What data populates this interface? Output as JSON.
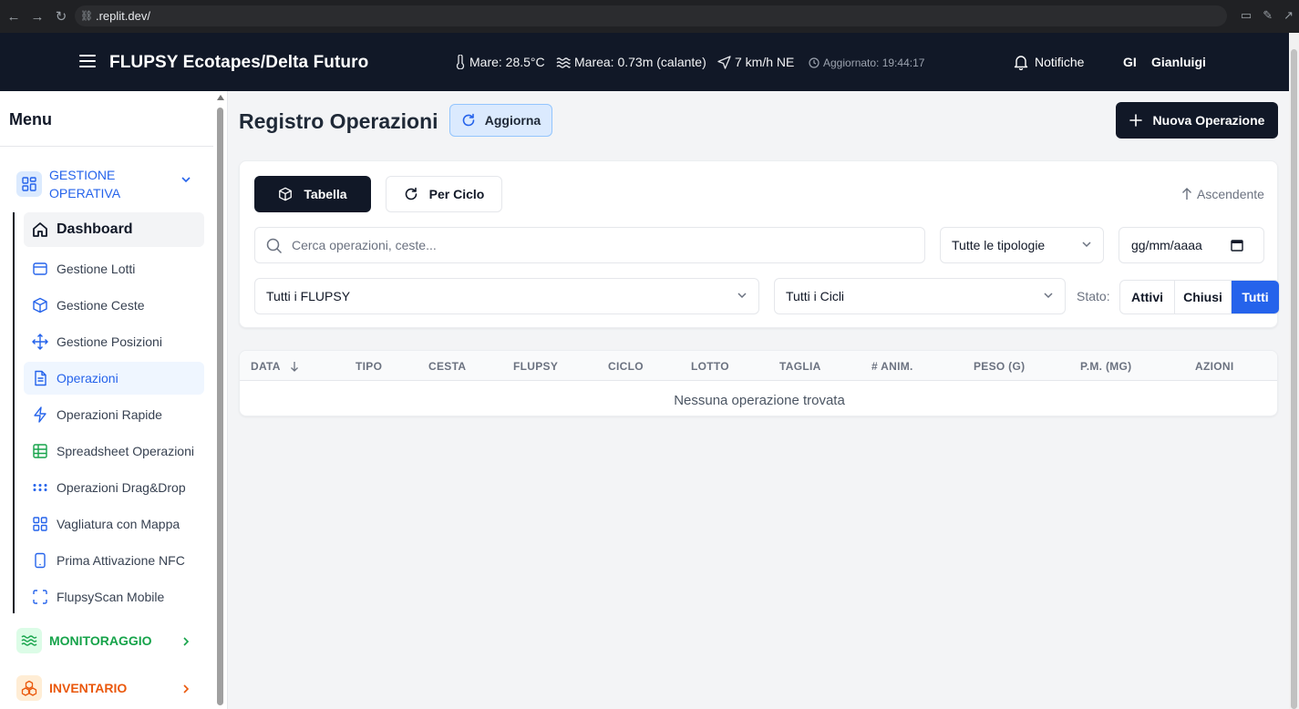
{
  "browser": {
    "url": ".replit.dev/"
  },
  "header": {
    "title": "FLUPSY Ecotapes/Delta Futuro",
    "sea_temp": "Mare: 28.5°C",
    "tide": "Marea: 0.73m (calante)",
    "wind": "7 km/h NE",
    "updated": "Aggiornato: 19:44:17",
    "notifications_label": "Notifiche",
    "user_initials": "GI",
    "user_name": "Gianluigi"
  },
  "sidebar": {
    "menu_title": "Menu",
    "section_gestione": "GESTIONE OPERATIVA",
    "items": [
      {
        "label": "Dashboard"
      },
      {
        "label": "Gestione Lotti"
      },
      {
        "label": "Gestione Ceste"
      },
      {
        "label": "Gestione Posizioni"
      },
      {
        "label": "Operazioni"
      },
      {
        "label": "Operazioni Rapide"
      },
      {
        "label": "Spreadsheet Operazioni"
      },
      {
        "label": "Operazioni Drag&Drop"
      },
      {
        "label": "Vagliatura con Mappa"
      },
      {
        "label": "Prima Attivazione NFC"
      },
      {
        "label": "FlupsyScan Mobile"
      }
    ],
    "section_monitoraggio": "MONITORAGGIO",
    "section_inventario": "INVENTARIO",
    "colors": {
      "active": "#2563eb",
      "monitoraggio": "#16a34a",
      "inventario": "#ea580c"
    }
  },
  "main": {
    "title": "Registro Operazioni",
    "refresh_label": "Aggiorna",
    "new_label": "Nuova Operazione",
    "view_table": "Tabella",
    "view_cycle": "Per Ciclo",
    "sort_label": "Ascendente",
    "search_placeholder": "Cerca operazioni, ceste...",
    "filter_type": "Tutte le tipologie",
    "date_placeholder": "gg/mm/aaaa",
    "filter_flupsy": "Tutti i FLUPSY",
    "filter_cycles": "Tutti i Cicli",
    "status_label": "Stato:",
    "status_options": [
      "Attivi",
      "Chiusi",
      "Tutti"
    ],
    "status_selected": "Tutti",
    "table": {
      "columns": [
        "DATA",
        "TIPO",
        "CESTA",
        "FLUPSY",
        "CICLO",
        "LOTTO",
        "TAGLIA",
        "# ANIM.",
        "PESO (G)",
        "P.M. (MG)",
        "AZIONI"
      ],
      "empty_message": "Nessuna operazione trovata"
    }
  }
}
